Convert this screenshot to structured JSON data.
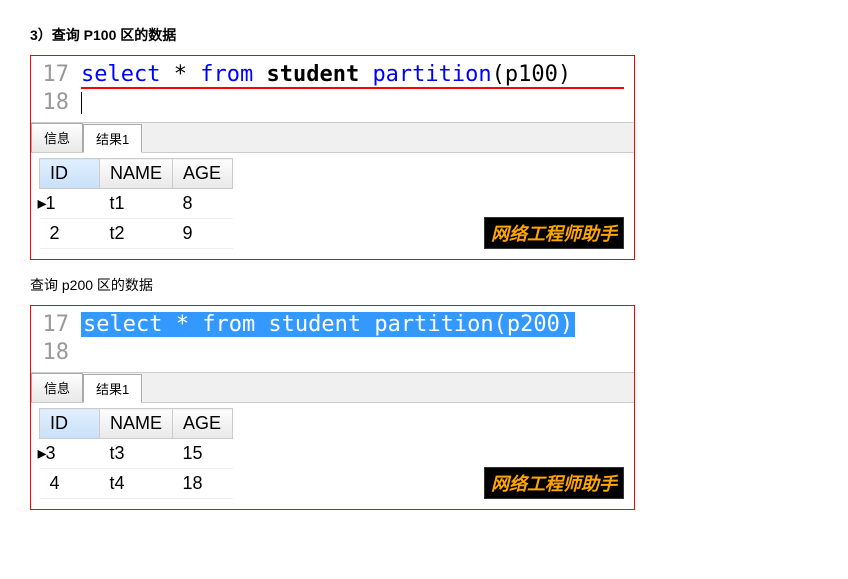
{
  "section1": {
    "title": "3）查询 P100 区的数据",
    "code": {
      "line_num_1": "17",
      "line_num_2": "18",
      "select": "select",
      "star": "*",
      "from": "from",
      "student": "student",
      "partition": "partition",
      "param": "(p100)"
    },
    "tabs": {
      "info": "信息",
      "result1": "结果1"
    },
    "table": {
      "headers": {
        "id": "ID",
        "name": "NAME",
        "age": "AGE"
      },
      "rows": [
        {
          "id": "1",
          "name": "t1",
          "age": "8"
        },
        {
          "id": "2",
          "name": "t2",
          "age": "9"
        }
      ]
    },
    "watermark": "网络工程师助手"
  },
  "section2": {
    "title": "查询 p200 区的数据",
    "code": {
      "line_num_1": "17",
      "line_num_2": "18",
      "full": "select * from student partition(p200)"
    },
    "tabs": {
      "info": "信息",
      "result1": "结果1"
    },
    "table": {
      "headers": {
        "id": "ID",
        "name": "NAME",
        "age": "AGE"
      },
      "rows": [
        {
          "id": "3",
          "name": "t3",
          "age": "15"
        },
        {
          "id": "4",
          "name": "t4",
          "age": "18"
        }
      ]
    },
    "watermark": "网络工程师助手"
  }
}
